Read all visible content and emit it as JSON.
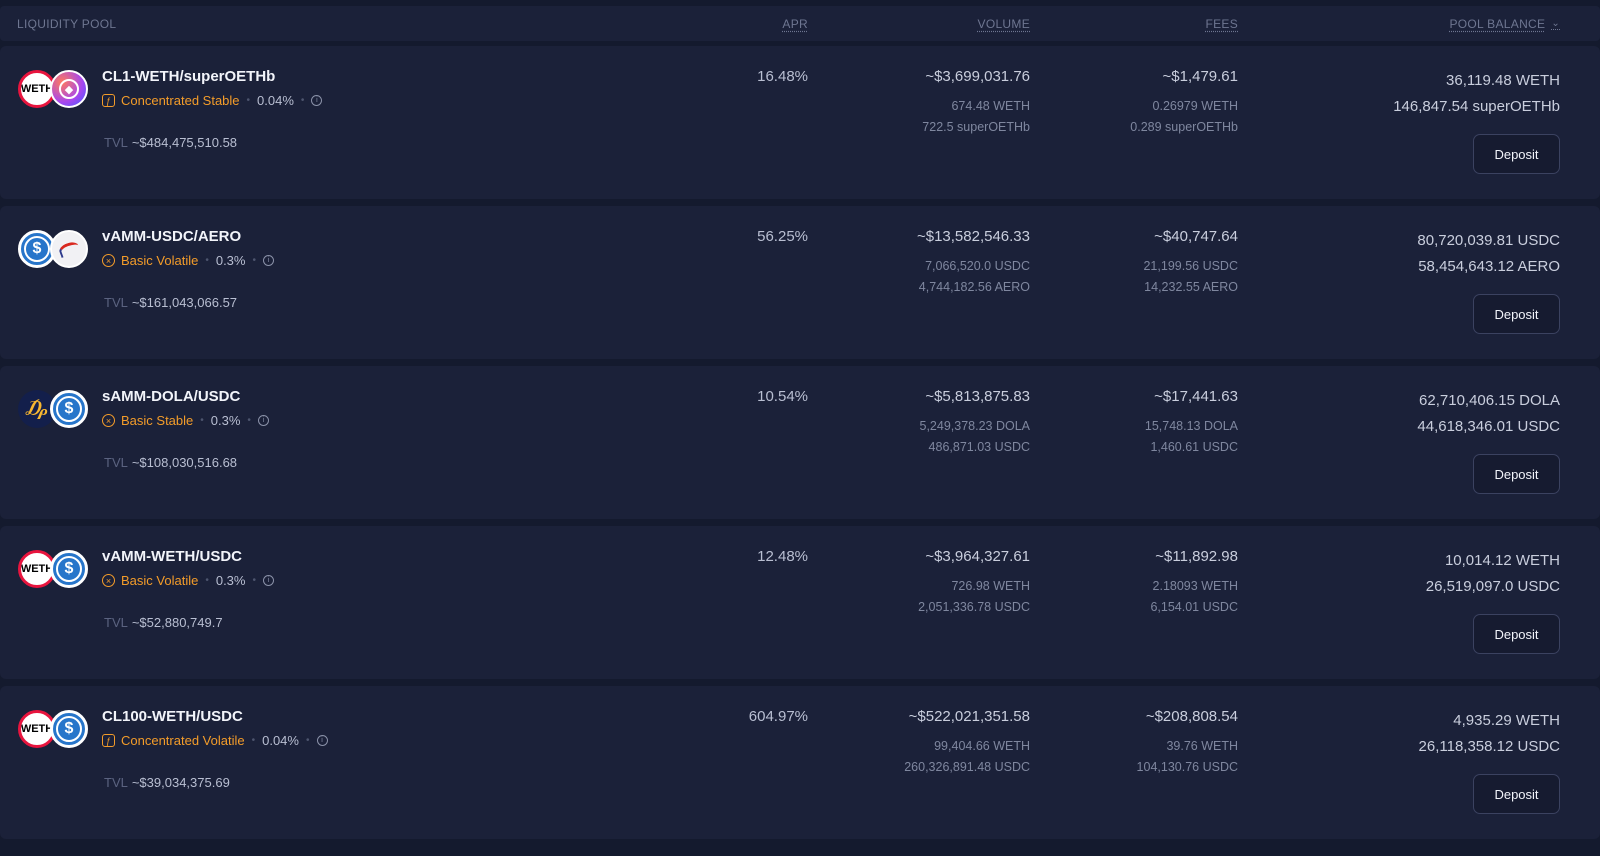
{
  "header": {
    "pool": "LIQUIDITY POOL",
    "apr": "APR",
    "volume": "VOLUME",
    "fees": "FEES",
    "balance": "POOL BALANCE",
    "balance_icon": "chevron-down-icon"
  },
  "colors": {
    "accent": "#f39c2a",
    "row_bg": "#1b2139",
    "page_bg": "#141a2e"
  },
  "pools": [
    {
      "token1": "WETH",
      "token1_icon": "weth-icon",
      "token2": "superOETHb",
      "token2_icon": "superoethb-icon",
      "pair": "CL1-WETH/superOETHb",
      "kind": "Concentrated Stable",
      "kind_icon": "concentrated-icon",
      "fee": "0.04%",
      "tvl_label": "TVL",
      "tvl": "~$484,475,510.58",
      "apr": "16.48%",
      "volume": "~$3,699,031.76",
      "volume_a": "674.48 WETH",
      "volume_b": "722.5 superOETHb",
      "fees": "~$1,479.61",
      "fees_a": "0.26979 WETH",
      "fees_b": "0.289 superOETHb",
      "balance_a": "36,119.48 WETH",
      "balance_b": "146,847.54 superOETHb",
      "deposit": "Deposit"
    },
    {
      "token1": "USDC",
      "token1_icon": "usdc-icon",
      "token2": "AERO",
      "token2_icon": "aero-icon",
      "pair": "vAMM-USDC/AERO",
      "kind": "Basic Volatile",
      "kind_icon": "basic-icon",
      "fee": "0.3%",
      "tvl_label": "TVL",
      "tvl": "~$161,043,066.57",
      "apr": "56.25%",
      "volume": "~$13,582,546.33",
      "volume_a": "7,066,520.0 USDC",
      "volume_b": "4,744,182.56 AERO",
      "fees": "~$40,747.64",
      "fees_a": "21,199.56 USDC",
      "fees_b": "14,232.55 AERO",
      "balance_a": "80,720,039.81 USDC",
      "balance_b": "58,454,643.12 AERO",
      "deposit": "Deposit"
    },
    {
      "token1": "DOLA",
      "token1_icon": "dola-icon",
      "token2": "USDC",
      "token2_icon": "usdc-icon",
      "pair": "sAMM-DOLA/USDC",
      "kind": "Basic Stable",
      "kind_icon": "basic-icon",
      "fee": "0.3%",
      "tvl_label": "TVL",
      "tvl": "~$108,030,516.68",
      "apr": "10.54%",
      "volume": "~$5,813,875.83",
      "volume_a": "5,249,378.23 DOLA",
      "volume_b": "486,871.03 USDC",
      "fees": "~$17,441.63",
      "fees_a": "15,748.13 DOLA",
      "fees_b": "1,460.61 USDC",
      "balance_a": "62,710,406.15 DOLA",
      "balance_b": "44,618,346.01 USDC",
      "deposit": "Deposit"
    },
    {
      "token1": "WETH",
      "token1_icon": "weth-icon",
      "token2": "USDC",
      "token2_icon": "usdc-icon",
      "pair": "vAMM-WETH/USDC",
      "kind": "Basic Volatile",
      "kind_icon": "basic-icon",
      "fee": "0.3%",
      "tvl_label": "TVL",
      "tvl": "~$52,880,749.7",
      "apr": "12.48%",
      "volume": "~$3,964,327.61",
      "volume_a": "726.98 WETH",
      "volume_b": "2,051,336.78 USDC",
      "fees": "~$11,892.98",
      "fees_a": "2.18093 WETH",
      "fees_b": "6,154.01 USDC",
      "balance_a": "10,014.12 WETH",
      "balance_b": "26,519,097.0 USDC",
      "deposit": "Deposit"
    },
    {
      "token1": "WETH",
      "token1_icon": "weth-icon",
      "token2": "USDC",
      "token2_icon": "usdc-icon",
      "pair": "CL100-WETH/USDC",
      "kind": "Concentrated Volatile",
      "kind_icon": "concentrated-icon",
      "fee": "0.04%",
      "tvl_label": "TVL",
      "tvl": "~$39,034,375.69",
      "apr": "604.97%",
      "volume": "~$522,021,351.58",
      "volume_a": "99,404.66 WETH",
      "volume_b": "260,326,891.48 USDC",
      "fees": "~$208,808.54",
      "fees_a": "39.76 WETH",
      "fees_b": "104,130.76 USDC",
      "balance_a": "4,935.29 WETH",
      "balance_b": "26,118,358.12 USDC",
      "deposit": "Deposit"
    }
  ]
}
